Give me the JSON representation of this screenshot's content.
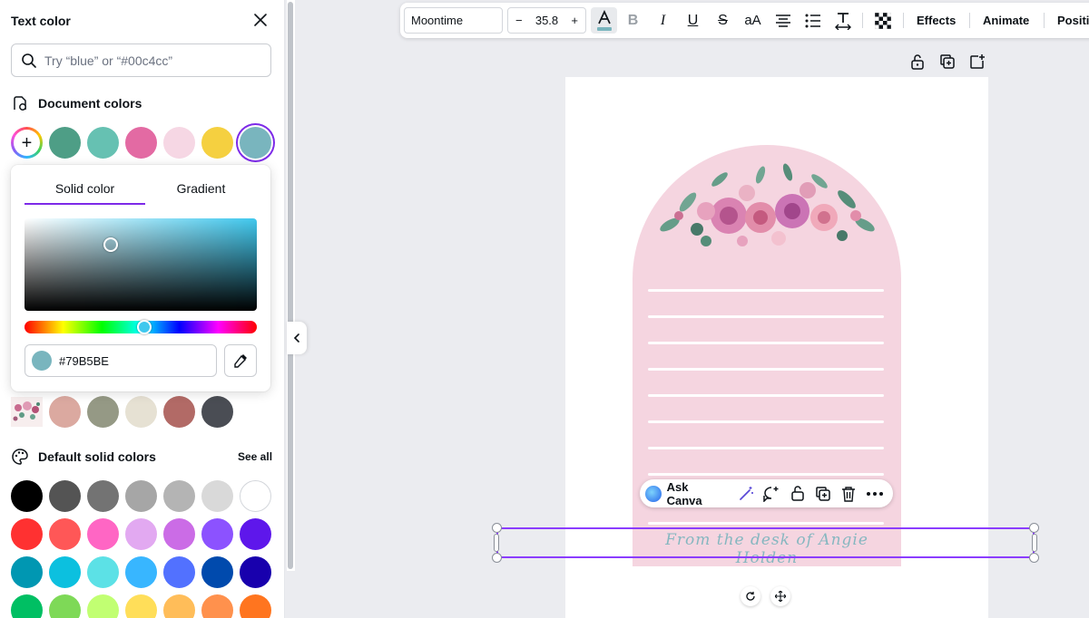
{
  "panel": {
    "title": "Text color",
    "search_placeholder": "Try “blue” or “#00c4cc”",
    "document_colors_label": "Document colors",
    "document_colors": [
      "#4e9e86",
      "#66c1b2",
      "#e36aa3",
      "#f6d7e4",
      "#f5d040",
      "#79B5BE"
    ],
    "photo_colors": [
      "#dba9a0",
      "#959985",
      "#e6e1d3",
      "#b26a66",
      "#4a4d54"
    ],
    "default_colors_label": "Default solid colors",
    "see_all": "See all",
    "default_colors": [
      [
        "#000000",
        "#545454",
        "#737373",
        "#a6a6a6",
        "#b4b4b4",
        "#d9d9d9",
        "#ffffff"
      ],
      [
        "#ff3131",
        "#ff5757",
        "#ff66c4",
        "#e2a9f1",
        "#cb6ce6",
        "#8c52ff",
        "#5e17eb"
      ],
      [
        "#0097b2",
        "#0cc0df",
        "#5ce1e6",
        "#38b6ff",
        "#5271ff",
        "#004aad",
        "#1800ad"
      ],
      [
        "#00bf63",
        "#7ed957",
        "#c1ff72",
        "#ffde59",
        "#ffbd59",
        "#ff914d",
        "#ff751f"
      ]
    ]
  },
  "picker": {
    "tab_solid": "Solid color",
    "tab_gradient": "Gradient",
    "hex_value": "#79B5BE",
    "current_color": "#79B5BE"
  },
  "toolbar": {
    "font": "Moontime",
    "minus": "−",
    "size": "35.8",
    "plus": "+",
    "bold": "B",
    "italic": "I",
    "underline": "U",
    "strike": "S",
    "case": "aA",
    "effects": "Effects",
    "animate": "Animate",
    "position": "Positi"
  },
  "ask_canva": {
    "label": "Ask Canva"
  },
  "canvas": {
    "signature_text": "From the desk of Angie Holden"
  }
}
